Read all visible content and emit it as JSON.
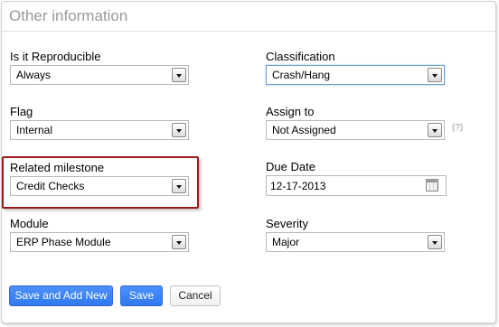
{
  "section": {
    "title": "Other information"
  },
  "fields": {
    "reproducible": {
      "label": "Is it Reproducible",
      "value": "Always"
    },
    "classification": {
      "label": "Classification",
      "value": "Crash/Hang"
    },
    "flag": {
      "label": "Flag",
      "value": "Internal"
    },
    "assign_to": {
      "label": "Assign to",
      "value": "Not Assigned",
      "help": "(?)"
    },
    "milestone": {
      "label": "Related milestone",
      "value": "Credit Checks"
    },
    "due_date": {
      "label": "Due Date",
      "value": "12-17-2013"
    },
    "module": {
      "label": "Module",
      "value": "ERP Phase Module"
    },
    "severity": {
      "label": "Severity",
      "value": "Major"
    }
  },
  "actions": {
    "save_add_new": "Save and Add New",
    "save": "Save",
    "cancel": "Cancel"
  },
  "colors": {
    "primary_button": "#3d84f5",
    "highlight_border": "#9b1b1b",
    "header_text": "#9a9a9a"
  }
}
